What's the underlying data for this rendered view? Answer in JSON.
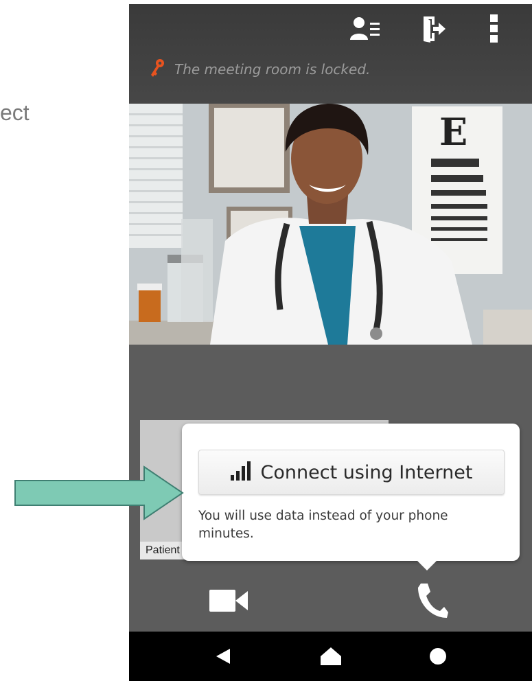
{
  "side_text": "ect",
  "header": {
    "icons": [
      "participants-icon",
      "exit-icon",
      "more-vert-icon"
    ],
    "lock_message": "The meeting room is locked."
  },
  "thumbnail": {
    "label": "Patient"
  },
  "popover": {
    "connect_label": "Connect using Internet",
    "note": "You will use data instead of your phone minutes."
  },
  "controls": [
    "video-camera-icon",
    "phone-icon"
  ],
  "navbar": [
    "back-icon",
    "home-icon",
    "recents-icon"
  ],
  "colors": {
    "key": "#e8531f",
    "arrow_fill": "#7ecab4",
    "arrow_stroke": "#3f7f72",
    "topbar": "#3f3f3f",
    "panel": "#5c5c5c"
  }
}
